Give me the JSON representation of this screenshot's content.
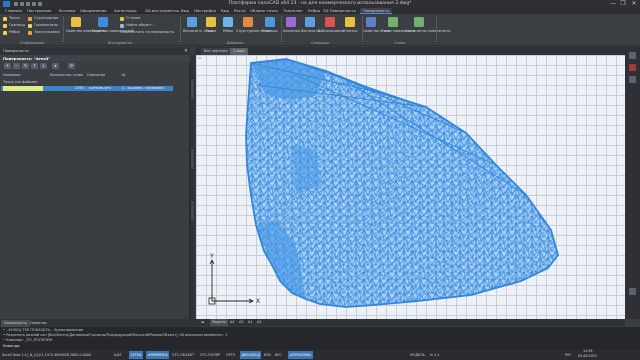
{
  "window": {
    "title": "Платформа nanoCAD x64 23 - не для коммерческого использования 2.dwg*",
    "minimize": "—",
    "maximize": "❐",
    "close": "✕"
  },
  "menu": [
    "Главная",
    "Построение",
    "Вставка",
    "Оформление",
    "Аннотации",
    "3D-инструменты",
    "Вид",
    "Настройки",
    "Вид",
    "Растр",
    "Облака точек",
    "Топоплан",
    "Ребра",
    "3D Поверхность",
    "Поверхность"
  ],
  "ribbon": {
    "groups": [
      {
        "label": "Отображение",
        "small": [
          "Точки",
          "Границы",
          "Рёбра"
        ],
        "small2": [
          "Структурные",
          "Горизонтали",
          "Треугольники"
        ],
        "icon_colors": [
          "#f0d24a",
          "#f0d24a",
          "#f0d24a",
          "#f0a04a",
          "#f0d24a",
          "#f0a04a"
        ]
      },
      {
        "label": "Инструменты",
        "big": [
          "Свойства поверхность",
          "Редактор поверхностей"
        ],
        "small": [
          "О точке",
          "Найти объект..."
        ],
        "dropdown": "Переместить на поверхность"
      },
      {
        "label": "Операции с объектами",
        "big": [
          "Исключить точки",
          "Точки",
          "Рёбра",
          "Структурные линии",
          "Границы",
          "Изолинии",
          "Вертикали",
          "Заблокировать",
          "Отметки",
          "Свойства стиль",
          "Стили поверхности",
          "Стили меток поверхности"
        ]
      }
    ],
    "group_labels": [
      "Отображение",
      "Инструменты",
      "Добавить",
      "Операции",
      "Стили"
    ]
  },
  "doc_tabs": [
    "Все чертежи",
    "2.dwg*"
  ],
  "panel": {
    "header": "Поверхность",
    "title": "Поверхность: \"Area3\"",
    "columns": [
      "Название",
      "Количество точек",
      "Описание",
      "Id"
    ],
    "tree_root": "Точки (по файлам)",
    "row": {
      "count": "2395",
      "name": "surfaces.xml",
      "state": "1 - eLoaded - eActivated"
    }
  },
  "side_tabs": [
    "Свойства",
    "Поверхность",
    "Команды"
  ],
  "layout_tabs": [
    "Модель",
    "A4",
    "A3",
    "A1",
    "A2"
  ],
  "bottom_tabs": [
    "Поверхность",
    "Свойства"
  ],
  "command_lines": [
    "• - КОНЕЦ ТЕК ПОКАЗАТЬ: - Бумагирование",
    "• Разрезать размай сон [Всё/Центр/Динамика/Границы/Предыдущий/Масштаб/Рамка/Объект] <В реальном времени>: 1",
    "• Команда: _ПО_ПОЛЯЛУЖ",
    "Команда:"
  ],
  "status": {
    "coords": "Area3 Area 1:1(_N_1|1)(1,1972.4809036 2082.0.0000",
    "toggles": [
      "ШАГ",
      "СЕТКА",
      "оПРИВЯЗКА",
      "ОТС-ОБЪЕКТ",
      "ОТС-ПОЛЯР",
      "ОРТО",
      "ДИН-ВВОД",
      "ИЗО",
      "ВЕС",
      "ШТРИХОВКА"
    ],
    "toggles_on": [
      false,
      true,
      true,
      false,
      false,
      false,
      true,
      false,
      false,
      true
    ],
    "right": "МОДЕЛЬ",
    "scale": "m 1:1",
    "lang": "РУС",
    "time": "14:58",
    "date": "05.06.2023"
  }
}
